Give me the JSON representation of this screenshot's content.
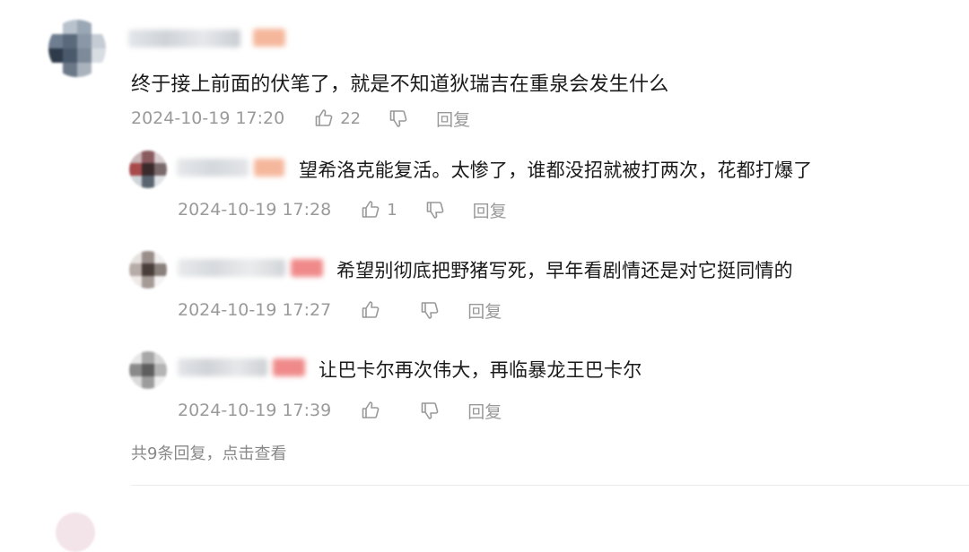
{
  "comments": [
    {
      "text": "终于接上前面的伏笔了，就是不知道狄瑞吉在重泉会发生什么",
      "time": "2024-10-19 17:20",
      "likes": "22",
      "reply_label": "回复",
      "avatar_pixels": [
        "#ffffff",
        "#b8c2cc",
        "#9aa7b5",
        "#ffffff",
        "#6e7e90",
        "#5a6a7c",
        "#8a97a6",
        "#c5ccd4",
        "#2f3b4a",
        "#4a5a6c",
        "#7d8a99",
        "#d8dde2",
        "#ffffff",
        "#6a7888",
        "#aab3bd",
        "#ffffff"
      ]
    }
  ],
  "replies": [
    {
      "text": "望希洛克能复活。太惨了，谁都没招就被打两次，花都打爆了",
      "time": "2024-10-19 17:28",
      "likes": "1",
      "reply_label": "回复",
      "avatar_pixels": [
        "#c9b6b8",
        "#8a5a5e",
        "#d9cfd1",
        "#a84a4a",
        "#3a2a2c",
        "#7a6a6c",
        "#cfd4d8",
        "#5a6470",
        "#e0e3e6"
      ]
    },
    {
      "text": "希望别彻底把野猪写死，早年看剧情还是对它挺同情的",
      "time": "2024-10-19 17:27",
      "likes": "",
      "reply_label": "回复",
      "avatar_pixels": [
        "#e6e2e0",
        "#9a8e8a",
        "#f0eeee",
        "#b8aca8",
        "#4a3e3a",
        "#8a807c",
        "#eeeae8",
        "#a49a96",
        "#f4f2f2"
      ]
    },
    {
      "text": "让巴卡尔再次伟大，再临暴龙王巴卡尔",
      "time": "2024-10-19 17:39",
      "likes": "",
      "reply_label": "回复",
      "avatar_pixels": [
        "#e8e8e8",
        "#a8a8a8",
        "#d8d8d8",
        "#8a8a8a",
        "#5e5e5e",
        "#b4b4b4",
        "#dadada",
        "#9c9c9c",
        "#eeeeee"
      ]
    }
  ],
  "more_replies": "共9条回复，点击查看",
  "colors": {
    "text": "#1a1a1a",
    "meta": "#999999",
    "username_blur_gray": "#d7dbe0",
    "username_blur_accent": "#f3b39a",
    "username_blur_red": "#f08a8a",
    "divider": "#ececec"
  },
  "icons": {
    "like": "thumbs-up-icon",
    "dislike": "thumbs-down-icon"
  }
}
